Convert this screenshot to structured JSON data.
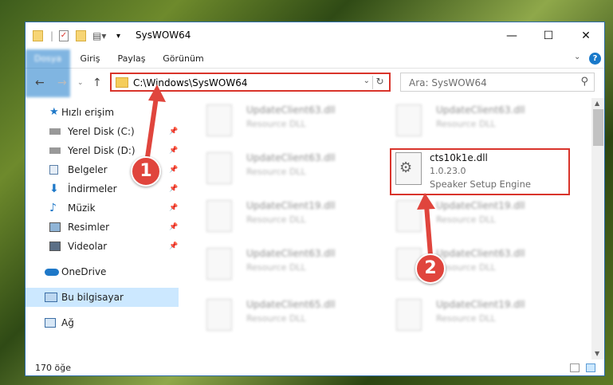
{
  "window": {
    "title": "SysWOW64"
  },
  "ribbon": {
    "tabs": [
      "Dosya",
      "Giriş",
      "Paylaş",
      "Görünüm"
    ]
  },
  "address": {
    "path": "C:\\Windows\\SysWOW64"
  },
  "search": {
    "placeholder": "Ara: SysWOW64"
  },
  "sidebar": {
    "items": [
      {
        "label": "Hızlı erişim",
        "icon": "star-icon"
      },
      {
        "label": "Yerel Disk (C:)",
        "icon": "drive-icon"
      },
      {
        "label": "Yerel Disk (D:)",
        "icon": "drive-icon"
      },
      {
        "label": "Belgeler",
        "icon": "documents-icon"
      },
      {
        "label": "İndirmeler",
        "icon": "downloads-icon"
      },
      {
        "label": "Müzik",
        "icon": "music-icon"
      },
      {
        "label": "Resimler",
        "icon": "pictures-icon"
      },
      {
        "label": "Videolar",
        "icon": "videos-icon"
      },
      {
        "label": "OneDrive",
        "icon": "cloud-icon"
      },
      {
        "label": "Bu bilgisayar",
        "icon": "computer-icon"
      },
      {
        "label": "Ağ",
        "icon": "network-icon"
      }
    ]
  },
  "files": [
    {
      "name": "UpdateClient63.dll",
      "type": "Resource DLL"
    },
    {
      "name": "UpdateClient63.dll",
      "type": "Resource DLL"
    },
    {
      "name": "UpdateClient63.dll",
      "type": "Resource DLL"
    },
    {
      "name": "UpdateClient19.dll",
      "type": "Resource DLL"
    },
    {
      "name": "UpdateClient19.dll",
      "type": "Resource DLL"
    },
    {
      "name": "UpdateClient63.dll",
      "type": "Resource DLL"
    },
    {
      "name": "UpdateClient63.dll",
      "type": "Resource DLL"
    },
    {
      "name": "UpdateClient65.dll",
      "type": "Resource DLL"
    },
    {
      "name": "UpdateClient19.dll",
      "type": "Resource DLL"
    }
  ],
  "highlighted_file": {
    "name": "cts10k1e.dll",
    "version": "1.0.23.0",
    "description": "Speaker Setup Engine"
  },
  "markers": [
    "1",
    "2"
  ],
  "status": {
    "count": "170 öğe"
  },
  "colors": {
    "accent": "#1979ca",
    "highlight": "#d9342b",
    "selection": "#cce8ff"
  }
}
